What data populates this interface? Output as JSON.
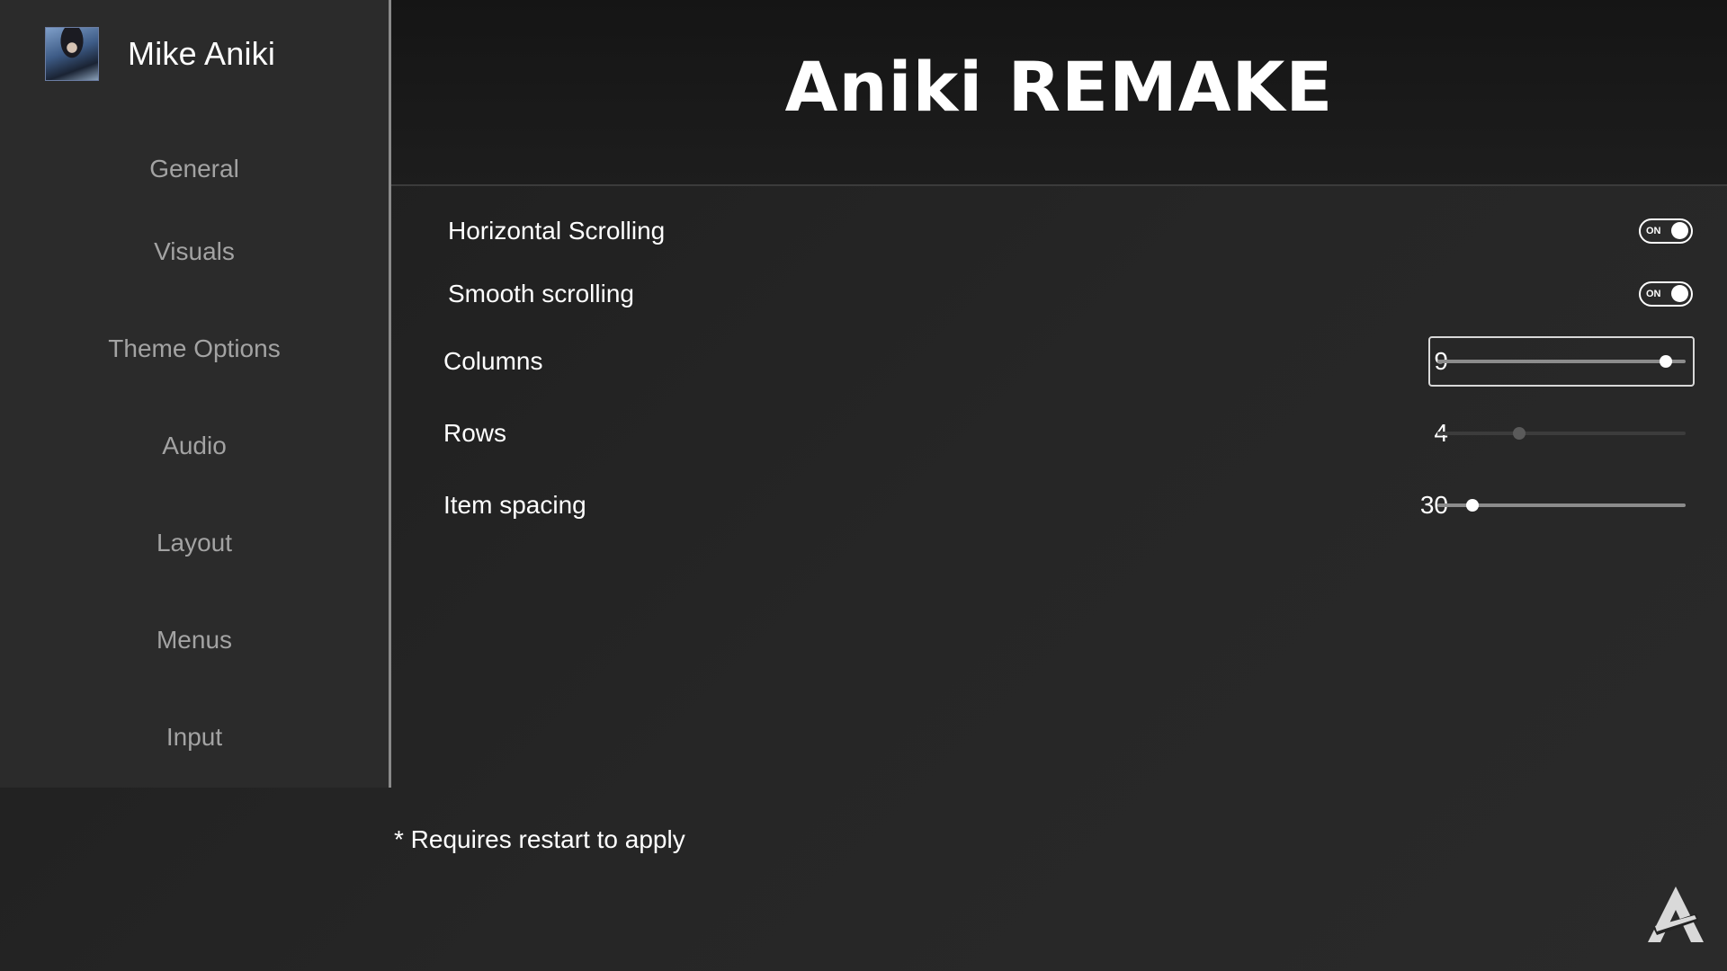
{
  "profile": {
    "name": "Mike Aniki"
  },
  "sidebar": {
    "items": [
      {
        "label": "General"
      },
      {
        "label": "Visuals"
      },
      {
        "label": "Theme Options"
      },
      {
        "label": "Audio"
      },
      {
        "label": "Layout"
      },
      {
        "label": "Menus"
      },
      {
        "label": "Input"
      }
    ]
  },
  "header": {
    "title": "Aniki REMAKE"
  },
  "settings": {
    "horizontal_scrolling": {
      "label": "Horizontal Scrolling",
      "state": "ON"
    },
    "smooth_scrolling": {
      "label": "Smooth scrolling",
      "state": "ON"
    },
    "columns": {
      "label": "Columns",
      "value": "9",
      "fraction": 0.92,
      "focused": true,
      "enabled": true
    },
    "rows": {
      "label": "Rows",
      "value": "4",
      "fraction": 0.33,
      "focused": false,
      "enabled": false
    },
    "item_spacing": {
      "label": "Item spacing",
      "value": "30",
      "fraction": 0.14,
      "focused": false,
      "enabled": true
    }
  },
  "footer": {
    "note": "* Requires restart to apply"
  },
  "icons": {
    "logo": "aniki-logo-icon",
    "avatar": "user-avatar"
  }
}
